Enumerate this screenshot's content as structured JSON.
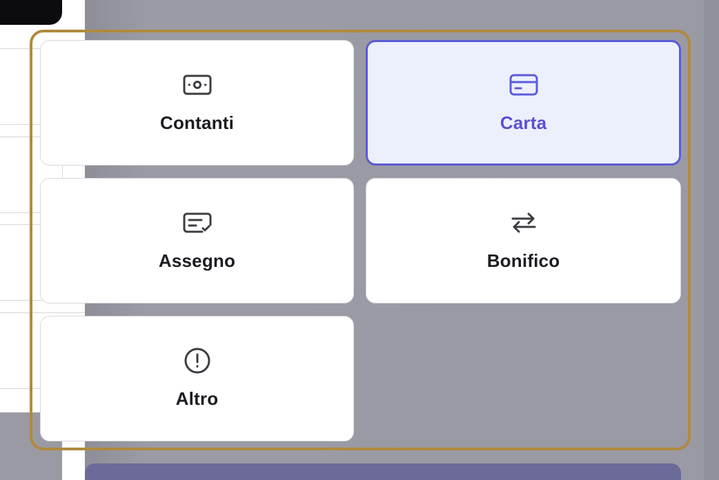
{
  "payment_methods": {
    "options": [
      {
        "label": "Contanti",
        "icon": "cash-icon",
        "selected": false
      },
      {
        "label": "Carta",
        "icon": "credit-card-icon",
        "selected": true
      },
      {
        "label": "Assegno",
        "icon": "check-icon",
        "selected": false
      },
      {
        "label": "Bonifico",
        "icon": "transfer-arrows-icon",
        "selected": false
      },
      {
        "label": "Altro",
        "icon": "alert-circle-icon",
        "selected": false
      }
    ],
    "selected_color": "#5b5bd6",
    "selected_background": "#ecf0fd",
    "focus_ring_color": "#b08a3e"
  }
}
